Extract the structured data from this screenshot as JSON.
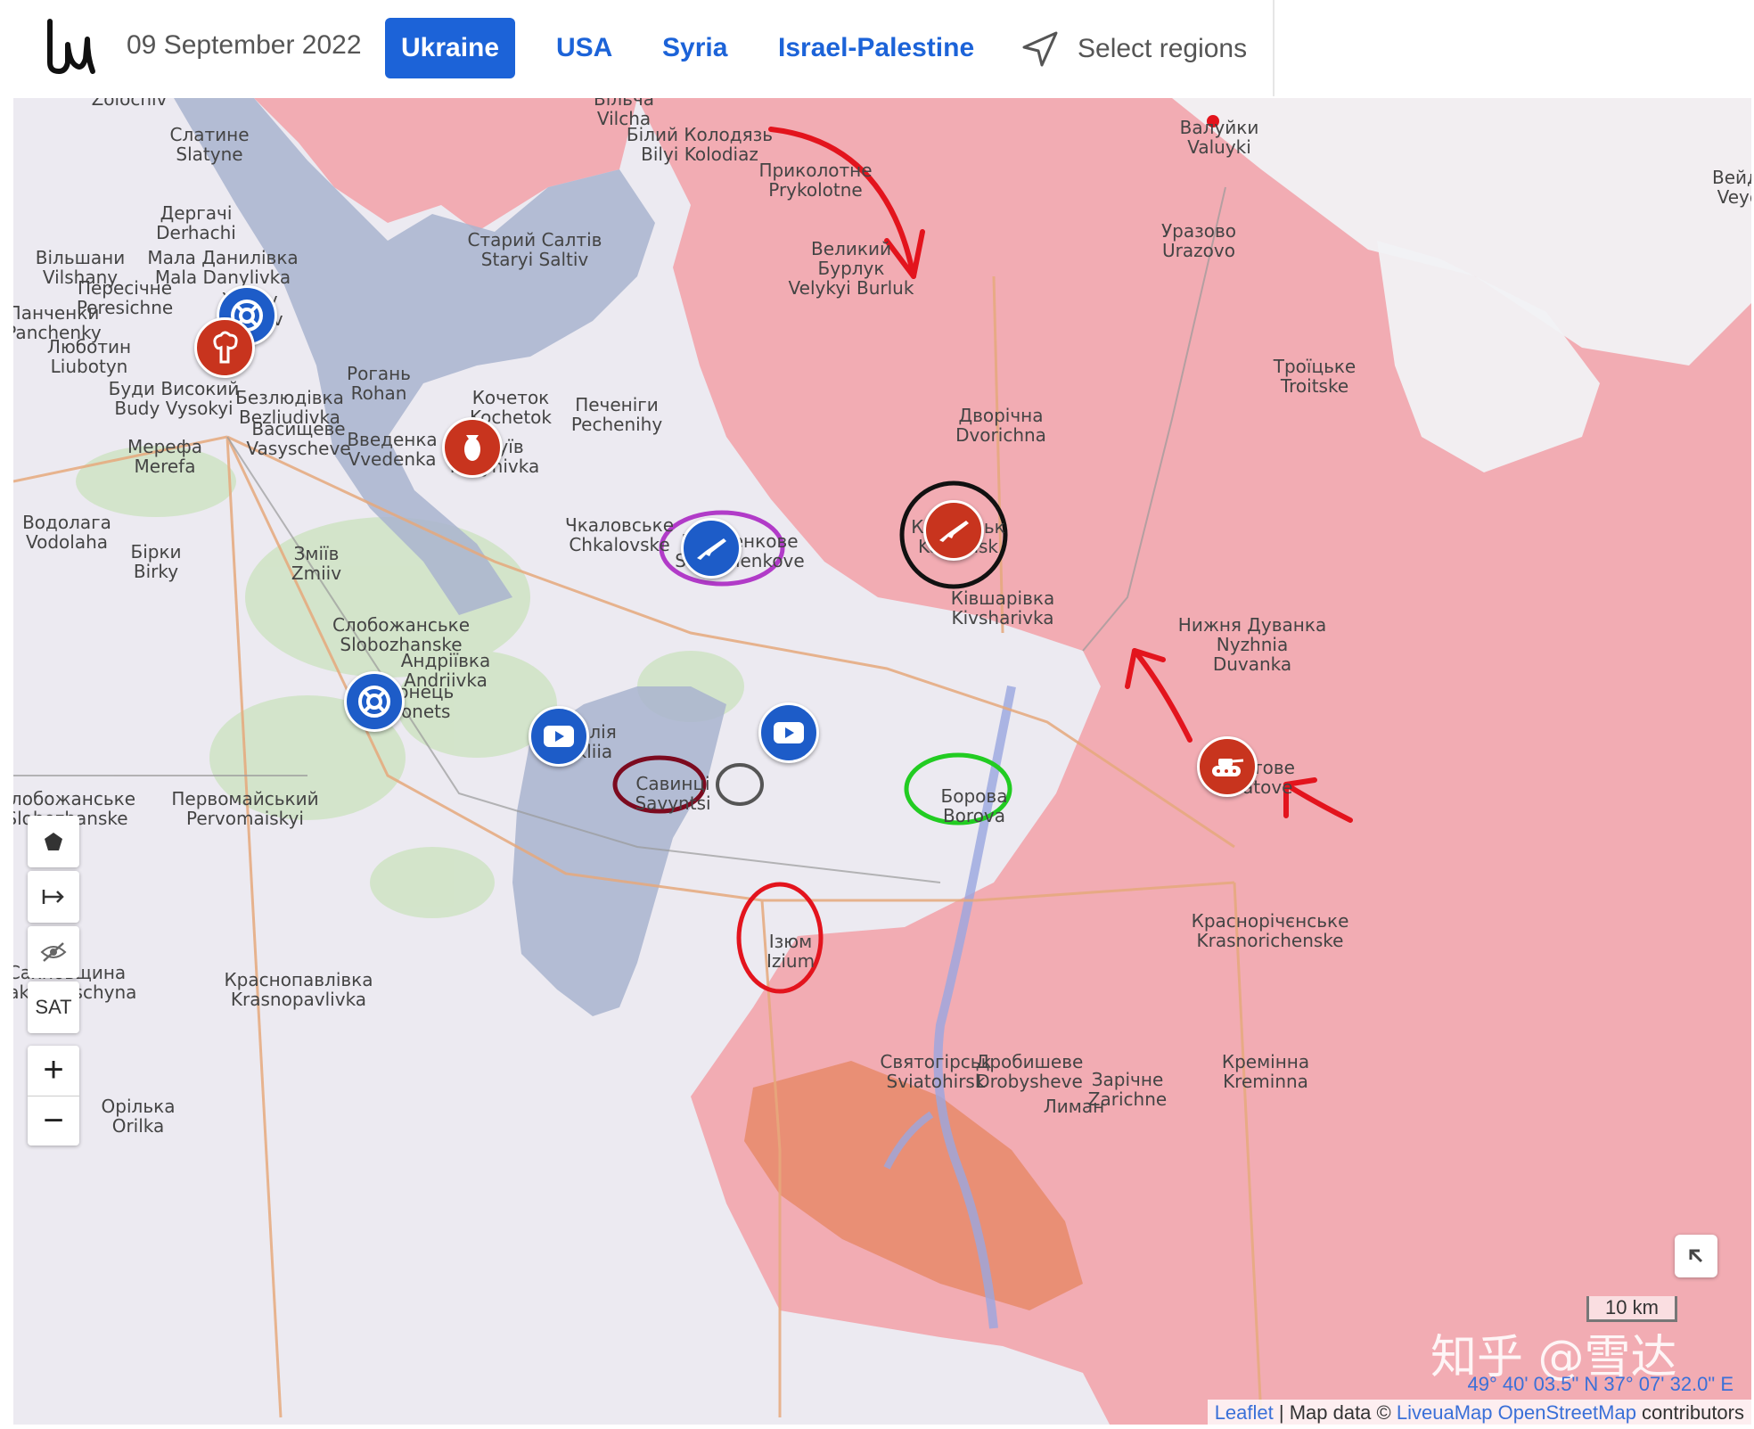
{
  "header": {
    "date": "09 September 2022",
    "tabs": [
      "Ukraine",
      "USA",
      "Syria",
      "Israel-Palestine"
    ],
    "active_tab": "Ukraine",
    "select_regions_label": "Select regions"
  },
  "colors": {
    "accent": "#1c63d8",
    "russian_control": "#f2a6ae",
    "ukr_advance": "#a9b4cf",
    "contested": "#e88a6a",
    "blue_marker": "#1d5cc8",
    "red_marker": "#c8341e"
  },
  "map": {
    "labels": [
      {
        "text": "Zolochiv"
      },
      {
        "text": "Слатине\nSlatyne"
      },
      {
        "text": "Вільча\nVilcha"
      },
      {
        "text": "Білий Колодязь\nBilyi Kolodiaz"
      },
      {
        "text": "Приколотне\nPrykolotne"
      },
      {
        "text": "Валуйки\nValuyki"
      },
      {
        "text": "Вейдел\nVeydel"
      },
      {
        "text": "Дергачі\nDerhachi"
      },
      {
        "text": "Старий Салтів\nStaryi Saltiv"
      },
      {
        "text": "Великий\nБурлук\nVelykyi Burluk"
      },
      {
        "text": "Уразово\nUrazovo"
      },
      {
        "text": "Вільшани\nVilshany"
      },
      {
        "text": "Мала Данилівка\nMala Danylivka"
      },
      {
        "text": "Пересічне\nPeresichne"
      },
      {
        "text": "Xarkiv\nKharkiv"
      },
      {
        "text": "Панченки\nPanchenky"
      },
      {
        "text": "Люботин\nLiubotyn"
      },
      {
        "text": "Рогань\nRohan"
      },
      {
        "text": "Буди Високий\nBudy Vysokyi"
      },
      {
        "text": "Безлюдівка\nBezliudivka"
      },
      {
        "text": "Васищеве\nVasyscheve"
      },
      {
        "text": "Кочеток\nKochetok"
      },
      {
        "text": "Печеніги\nPechenihy"
      },
      {
        "text": "Дворічна\nDvorichna"
      },
      {
        "text": "Троїцьке\nTroitske"
      },
      {
        "text": "Мерефа\nMerefa"
      },
      {
        "text": "Введенка\nVvedenka"
      },
      {
        "text": "Чугуїв\nMalynivka"
      },
      {
        "text": "Чкаловське\nChkalovske"
      },
      {
        "text": "Шевченкове\nShevchenkove"
      },
      {
        "text": "Купʼянськ\nKupiansk"
      },
      {
        "text": "Ківшарівка\nKivsharivka"
      },
      {
        "text": "Водолага\nVodolaha"
      },
      {
        "text": "Бірки\nBirky"
      },
      {
        "text": "Зміїв\nZmiiv"
      },
      {
        "text": "Нижня Дуванка\nNyzhnia\nDuvanka"
      },
      {
        "text": "Слобожанське\nSlobozhanske"
      },
      {
        "text": "Андріївка\nAndriivka"
      },
      {
        "text": "Донець\nDonets"
      },
      {
        "text": "Балаклія\nBalakliia"
      },
      {
        "text": "Савинці\nSavyntsi"
      },
      {
        "text": "Борова\nBorova"
      },
      {
        "text": "Сватове\nSvatove"
      },
      {
        "text": "Первомайський\nPervomaiskyi"
      },
      {
        "text": "Слобожанське\nSlobozhanske"
      },
      {
        "text": "Ізюм\nIzium"
      },
      {
        "text": "Краснорічєнське\nKrasnorichenske"
      },
      {
        "text": "Сахновщина\nSakhnovschyna"
      },
      {
        "text": "Краснопавлівка\nKrasnopavlivka"
      },
      {
        "text": "Святогірськ\nSviatohirsk"
      },
      {
        "text": "Дробишеве\nDrobysheve"
      },
      {
        "text": "Зарічне\nZarichne"
      },
      {
        "text": "Лиман"
      },
      {
        "text": "Кремінна\nKreminna"
      },
      {
        "text": "Орілька\nOrilka"
      }
    ],
    "markers": [
      {
        "name": "kharkiv-humanitarian-marker",
        "color": "blue",
        "icon": "lifebuoy-icon"
      },
      {
        "name": "kharkiv-explosion-marker",
        "color": "red",
        "icon": "explosion-icon"
      },
      {
        "name": "chuhuiv-bomb-marker",
        "color": "red",
        "icon": "bomb-icon"
      },
      {
        "name": "shevchenkove-rifle-marker",
        "color": "blue",
        "icon": "rifle-icon"
      },
      {
        "name": "kupiansk-rifle-marker",
        "color": "red",
        "icon": "rifle-icon"
      },
      {
        "name": "donets-humanitarian-marker",
        "color": "blue",
        "icon": "lifebuoy-icon"
      },
      {
        "name": "balakliia-video-marker",
        "color": "blue",
        "icon": "video-icon"
      },
      {
        "name": "savyntsi-video-marker",
        "color": "blue",
        "icon": "video-icon"
      },
      {
        "name": "svatove-tank-marker",
        "color": "red",
        "icon": "tank-icon"
      }
    ],
    "controls": {
      "draw_polygon_icon": "pentagon-icon",
      "measure_icon": "arrow-right-bar-icon",
      "hide_icon": "eye-off-icon",
      "sat_label": "SAT",
      "zoom_in": "+",
      "zoom_out": "−"
    },
    "scale_label": "10 km",
    "coordinates": "49° 40' 03.5\" N 37° 07' 32.0\" E",
    "attribution": {
      "leaflet": "Leaflet",
      "sep": " | Map data © ",
      "liveuamap": "LiveuaMap",
      "osm": "OpenStreetMap",
      "contributors": " contributors"
    },
    "watermark": "知乎 @雪达"
  }
}
